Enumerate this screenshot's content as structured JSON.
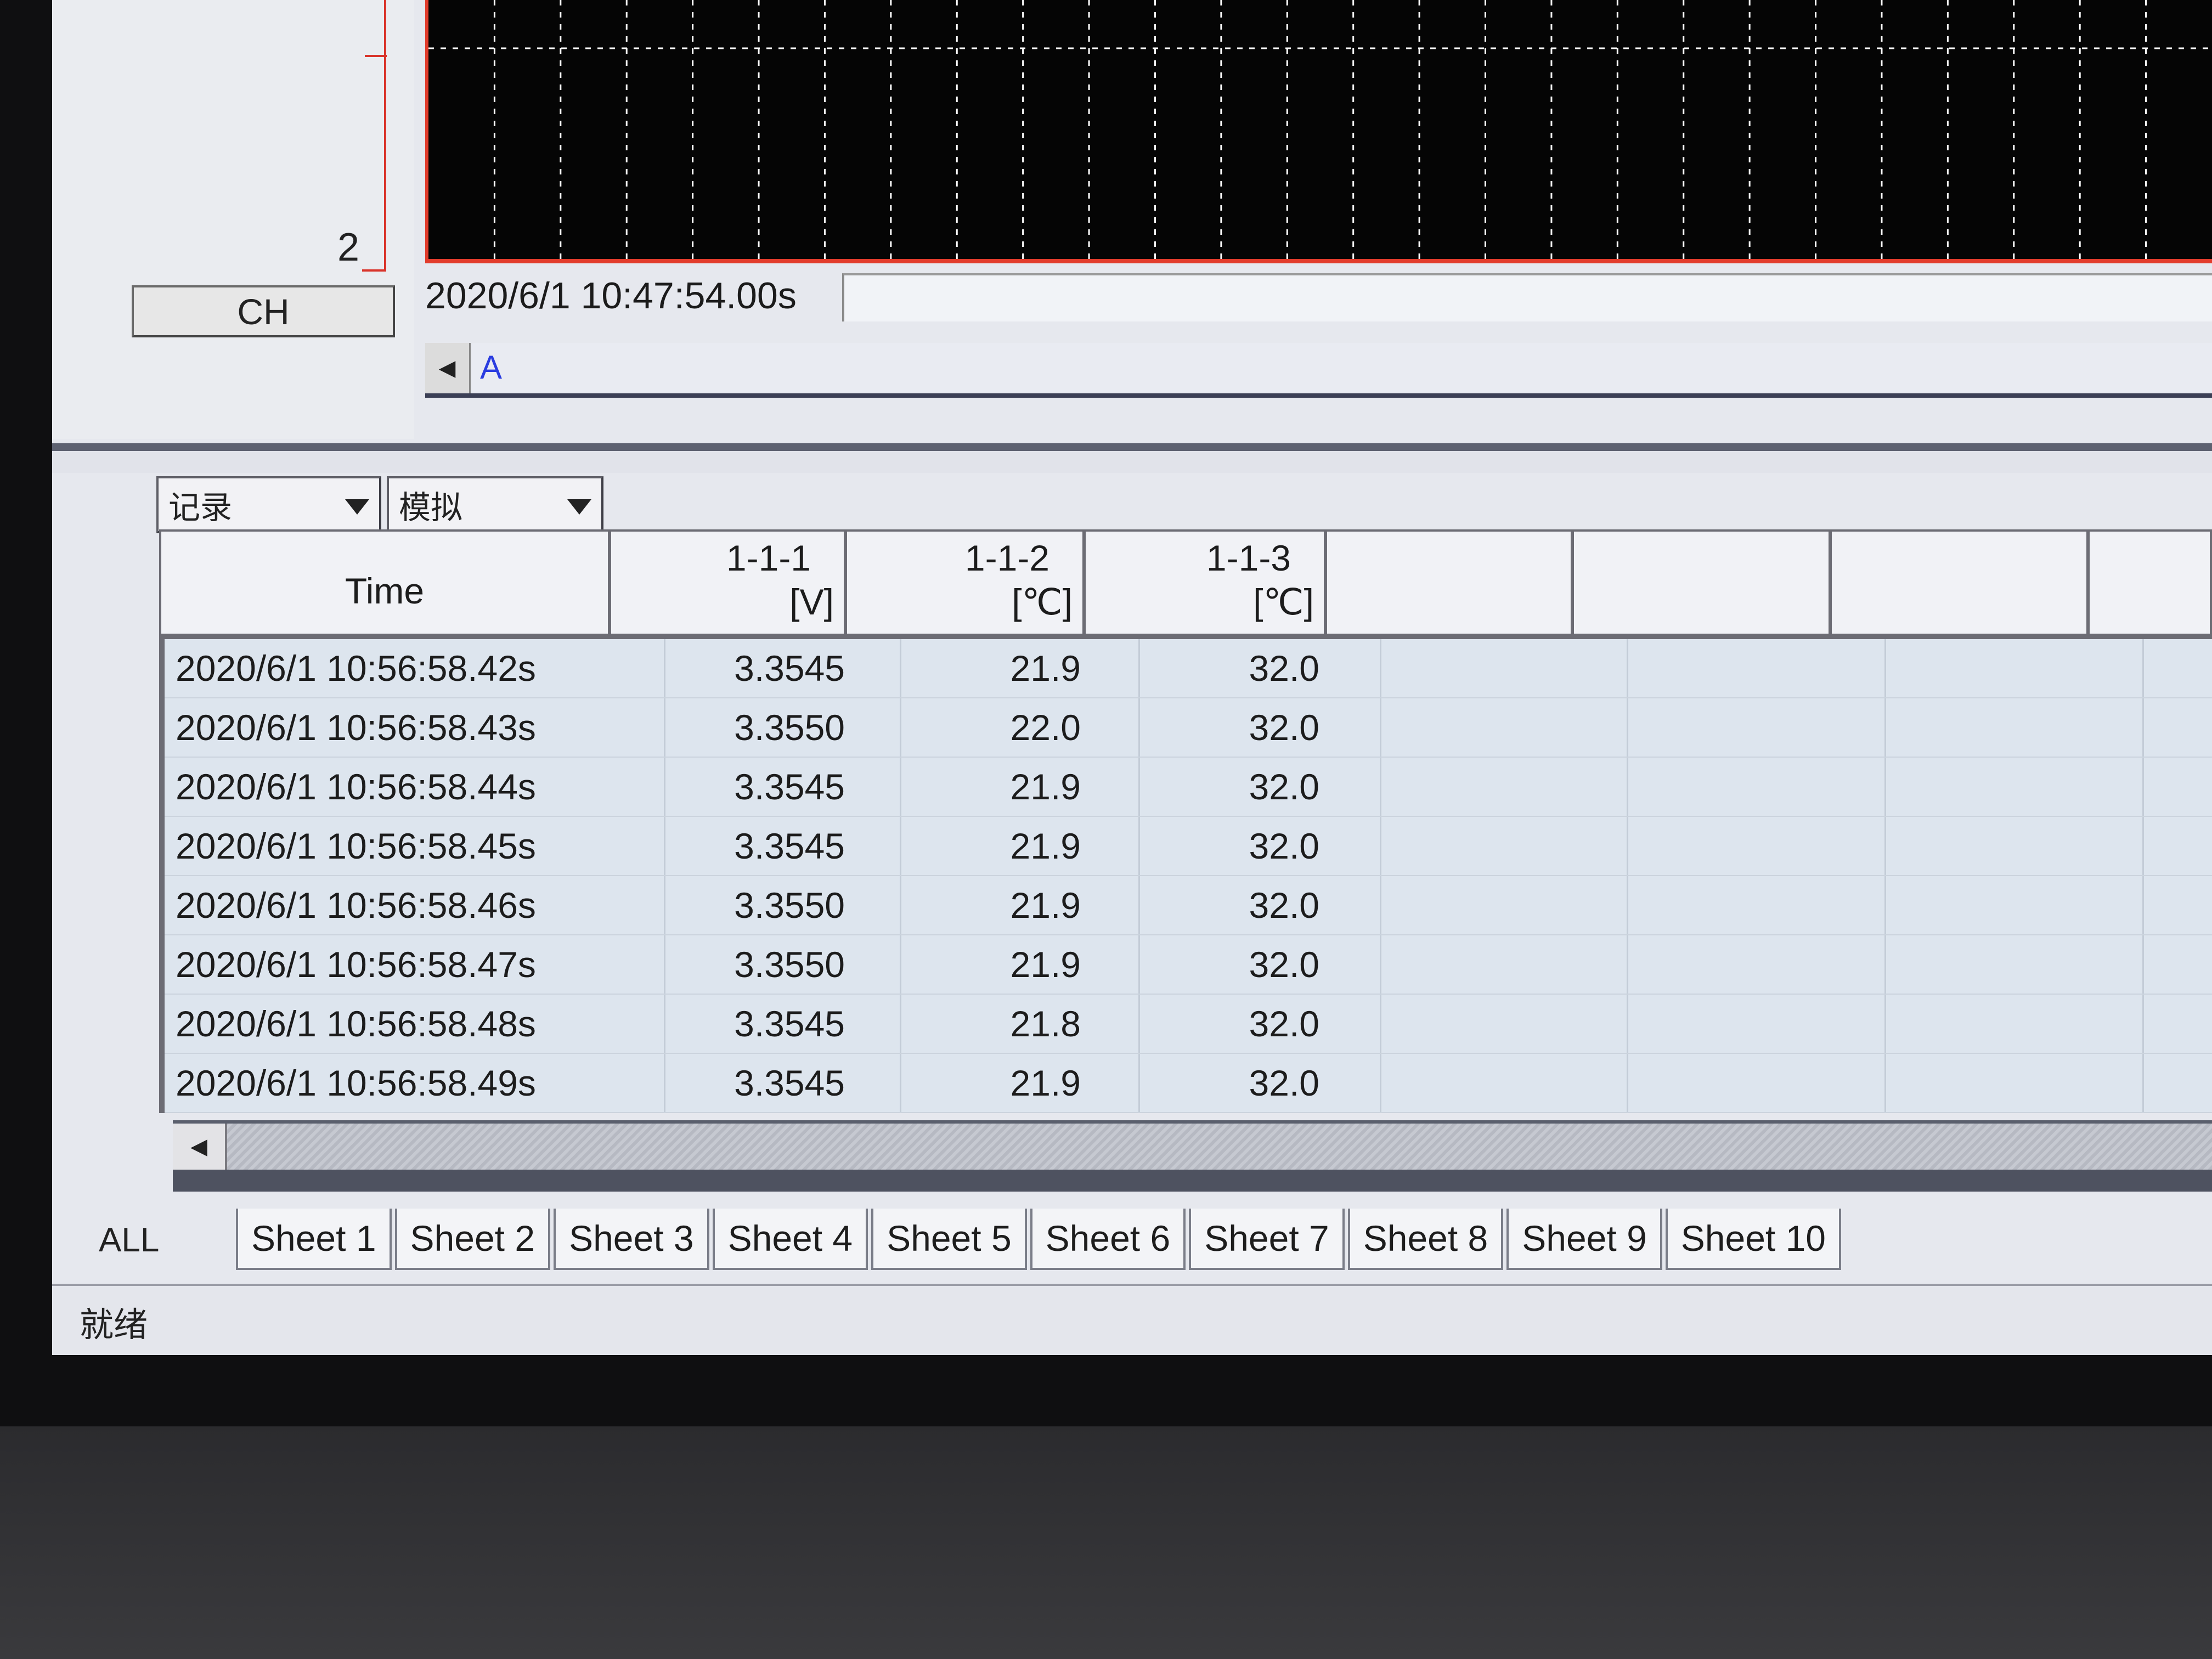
{
  "axis": {
    "bottom_label": "2"
  },
  "ch_button": "CH",
  "cursor_time": "2020/6/1 10:47:54.00s",
  "scroll_marker": "A",
  "dropdowns": [
    {
      "value": "记录"
    },
    {
      "value": "模拟"
    }
  ],
  "table": {
    "time_header": "Time",
    "channels": [
      {
        "id": "1-1-1",
        "unit": "[V]"
      },
      {
        "id": "1-1-2",
        "unit": "[℃]"
      },
      {
        "id": "1-1-3",
        "unit": "[℃]"
      }
    ],
    "rows": [
      {
        "time": "2020/6/1 10:56:58.42s",
        "v1": "3.3545",
        "v2": "21.9",
        "v3": "32.0"
      },
      {
        "time": "2020/6/1 10:56:58.43s",
        "v1": "3.3550",
        "v2": "22.0",
        "v3": "32.0"
      },
      {
        "time": "2020/6/1 10:56:58.44s",
        "v1": "3.3545",
        "v2": "21.9",
        "v3": "32.0"
      },
      {
        "time": "2020/6/1 10:56:58.45s",
        "v1": "3.3545",
        "v2": "21.9",
        "v3": "32.0"
      },
      {
        "time": "2020/6/1 10:56:58.46s",
        "v1": "3.3550",
        "v2": "21.9",
        "v3": "32.0"
      },
      {
        "time": "2020/6/1 10:56:58.47s",
        "v1": "3.3550",
        "v2": "21.9",
        "v3": "32.0"
      },
      {
        "time": "2020/6/1 10:56:58.48s",
        "v1": "3.3545",
        "v2": "21.8",
        "v3": "32.0"
      },
      {
        "time": "2020/6/1 10:56:58.49s",
        "v1": "3.3545",
        "v2": "21.9",
        "v3": "32.0"
      }
    ]
  },
  "tabs": {
    "all": "ALL",
    "sheets": [
      "Sheet 1",
      "Sheet 2",
      "Sheet 3",
      "Sheet 4",
      "Sheet 5",
      "Sheet 6",
      "Sheet 7",
      "Sheet 8",
      "Sheet 9",
      "Sheet 10"
    ]
  },
  "status": "就绪",
  "colors": {
    "axis_red": "#d9342b",
    "plot_bg": "#050505",
    "grid": "#ffffff",
    "marker_blue": "#2a3ce0"
  },
  "icons": {
    "dropdown": "caret-down-icon",
    "scroll_left": "arrow-left-icon"
  }
}
